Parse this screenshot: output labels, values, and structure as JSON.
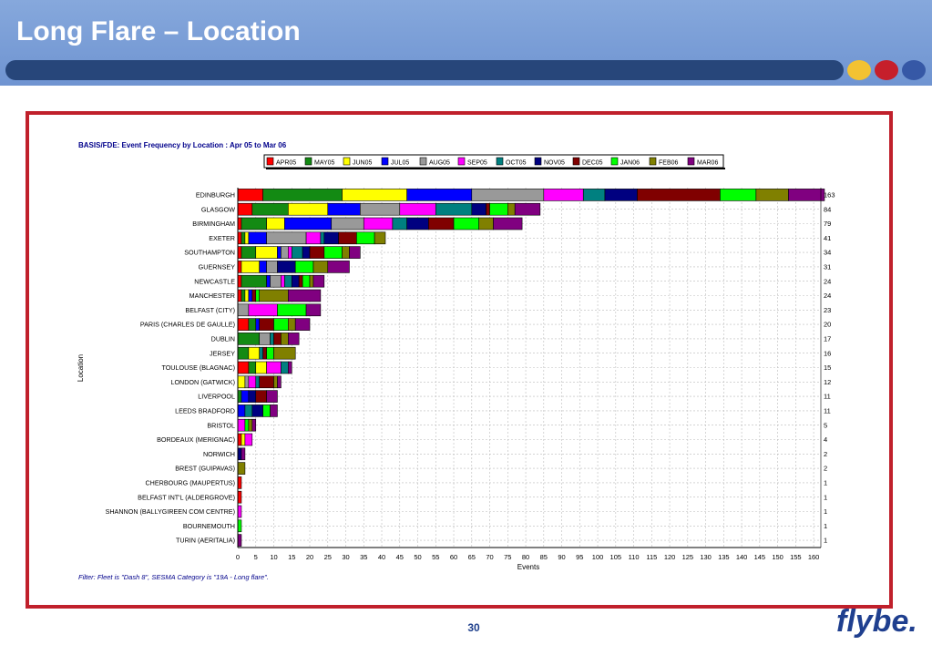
{
  "slide": {
    "title": "Long Flare – Location",
    "page_number": "30",
    "brand_name": "flybe."
  },
  "colors": {
    "header_bg": "#7a9ed8",
    "title_bar": "#27467a",
    "frame_border": "#c0202b",
    "dots": [
      "#f3c232",
      "#c61f2b",
      "#3658a6"
    ]
  },
  "chart_data": {
    "type": "bar",
    "orientation": "horizontal",
    "stacked": true,
    "title": "BASIS/FDE: Event Frequency by Location : Apr 05 to Mar 06",
    "xlabel": "Events",
    "ylabel": "Location",
    "xlim": [
      0,
      162
    ],
    "x_ticks": [
      0,
      5,
      10,
      15,
      20,
      25,
      30,
      35,
      40,
      45,
      50,
      55,
      60,
      65,
      70,
      75,
      80,
      85,
      90,
      95,
      100,
      105,
      110,
      115,
      120,
      125,
      130,
      135,
      140,
      145,
      150,
      155,
      160
    ],
    "grid": true,
    "legend_position": "top",
    "footnote": "Filter: Fleet is \"Dash 8\", SESMA Category is \"19A - Long flare\".",
    "series": [
      {
        "name": "APR05",
        "color": "#ff0000"
      },
      {
        "name": "MAY05",
        "color": "#138a13"
      },
      {
        "name": "JUN05",
        "color": "#ffff00"
      },
      {
        "name": "JUL05",
        "color": "#0000ff"
      },
      {
        "name": "AUG05",
        "color": "#999999"
      },
      {
        "name": "SEP05",
        "color": "#ff00ff"
      },
      {
        "name": "OCT05",
        "color": "#008080"
      },
      {
        "name": "NOV05",
        "color": "#000080"
      },
      {
        "name": "DEC05",
        "color": "#800000"
      },
      {
        "name": "JAN06",
        "color": "#00ff00"
      },
      {
        "name": "FEB06",
        "color": "#808000"
      },
      {
        "name": "MAR06",
        "color": "#800080"
      }
    ],
    "categories": [
      "EDINBURGH",
      "GLASGOW",
      "BIRMINGHAM",
      "EXETER",
      "SOUTHAMPTON",
      "GUERNSEY",
      "NEWCASTLE",
      "MANCHESTER",
      "BELFAST (CITY)",
      "PARIS (CHARLES DE GAULLE)",
      "DUBLIN",
      "JERSEY",
      "TOULOUSE (BLAGNAC)",
      "LONDON (GATWICK)",
      "LIVERPOOL",
      "LEEDS BRADFORD",
      "BRISTOL",
      "BORDEAUX (MERIGNAC)",
      "NORWICH",
      "BREST (GUIPAVAS)",
      "CHERBOURG (MAUPERTUS)",
      "BELFAST INT'L (ALDERGROVE)",
      "SHANNON (BALLYGIREEN COM CENTRE)",
      "BOURNEMOUTH",
      "TURIN (AERITALIA)"
    ],
    "totals": [
      163,
      84,
      79,
      41,
      34,
      31,
      24,
      24,
      23,
      20,
      17,
      16,
      15,
      12,
      11,
      11,
      5,
      4,
      2,
      2,
      1,
      1,
      1,
      1,
      1
    ],
    "values": [
      [
        7,
        22,
        18,
        18,
        20,
        11,
        6,
        9,
        23,
        10,
        9,
        10
      ],
      [
        4,
        10,
        11,
        9,
        11,
        10,
        10,
        4,
        1,
        5,
        2,
        7
      ],
      [
        1,
        7,
        5,
        13,
        9,
        8,
        4,
        6,
        7,
        7,
        4,
        8
      ],
      [
        1,
        1,
        1,
        5,
        11,
        4,
        1,
        4,
        5,
        5,
        3,
        0
      ],
      [
        1,
        4,
        6,
        1,
        2,
        1,
        3,
        2,
        4,
        5,
        2,
        3
      ],
      [
        1,
        0,
        5,
        2,
        3,
        0,
        0,
        5,
        0,
        5,
        4,
        6
      ],
      [
        1,
        7,
        0,
        1,
        3,
        1,
        2,
        2,
        1,
        2,
        1,
        3
      ],
      [
        1,
        1,
        1,
        1,
        0,
        0,
        0,
        0,
        1,
        1,
        8,
        9
      ],
      [
        0,
        0,
        0,
        0,
        3,
        8,
        0,
        0,
        0,
        8,
        0,
        4
      ],
      [
        3,
        2,
        0,
        1,
        0,
        0,
        0,
        0,
        4,
        4,
        2,
        4
      ],
      [
        0,
        6,
        0,
        0,
        3,
        0,
        1,
        0,
        2,
        0,
        2,
        3
      ],
      [
        0,
        3,
        3,
        0,
        0,
        0,
        1,
        0,
        1,
        2,
        6,
        0
      ],
      [
        3,
        2,
        3,
        0,
        0,
        4,
        2,
        0,
        0,
        0,
        0,
        1
      ],
      [
        0,
        0,
        2,
        0,
        1,
        2,
        1,
        0,
        4,
        0,
        1,
        1
      ],
      [
        0,
        1,
        0,
        2,
        0,
        0,
        0,
        2,
        3,
        0,
        0,
        3
      ],
      [
        0,
        0,
        0,
        2,
        0,
        0,
        2,
        3,
        0,
        2,
        0,
        2
      ],
      [
        0,
        0,
        0,
        0,
        0,
        2,
        0,
        0,
        0,
        1,
        1,
        1
      ],
      [
        1,
        0,
        1,
        0,
        0,
        2,
        0,
        0,
        0,
        0,
        0,
        0
      ],
      [
        0,
        0,
        0,
        0,
        0,
        0,
        0,
        1,
        0,
        0,
        0,
        1
      ],
      [
        0,
        0,
        0,
        0,
        0,
        0,
        0,
        0,
        0,
        0,
        2,
        0
      ],
      [
        1,
        0,
        0,
        0,
        0,
        0,
        0,
        0,
        0,
        0,
        0,
        0
      ],
      [
        1,
        0,
        0,
        0,
        0,
        0,
        0,
        0,
        0,
        0,
        0,
        0
      ],
      [
        0,
        0,
        0,
        0,
        0,
        1,
        0,
        0,
        0,
        0,
        0,
        0
      ],
      [
        0,
        0,
        0,
        0,
        0,
        0,
        0,
        0,
        0,
        1,
        0,
        0
      ],
      [
        0,
        0,
        0,
        0,
        0,
        0,
        0,
        0,
        0,
        0,
        0,
        1
      ]
    ]
  }
}
